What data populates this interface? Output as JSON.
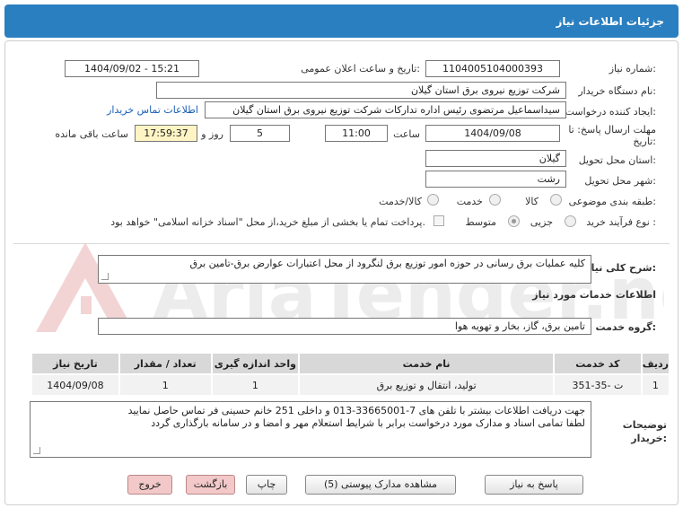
{
  "header": {
    "title": "جزئیات اطلاعات نیاز"
  },
  "fields": {
    "need_number_label": "شماره نیاز:",
    "need_number": "1104005104000393",
    "announce_label": "تاریخ و ساعت اعلان عمومی:",
    "announce_value": "1404/09/02 - 15:21",
    "buyer_org_label": "نام دستگاه خریدار:",
    "buyer_org": "شرکت توزیع نیروی برق استان گیلان",
    "creator_label": "ایجاد کننده درخواست:",
    "creator": "سیداسماعیل مرتضوی رئیس اداره تدارکات شرکت توزیع نیروی برق استان گیلان",
    "contact_link": "اطلاعات تماس خریدار",
    "deadline_label": "مهلت ارسال پاسخ: تا تاریخ:",
    "deadline_date": "1404/09/08",
    "time_label": "ساعت",
    "deadline_time": "11:00",
    "days_value": "5",
    "days_label": "روز و",
    "remaining_time": "17:59:37",
    "remaining_label": "ساعت باقی مانده",
    "province_label": "استان محل تحویل:",
    "province": "گیلان",
    "city_label": "شهر محل تحویل:",
    "city": "رشت",
    "category_label": "طبقه بندی موضوعی:",
    "category_options": [
      "کالا",
      "خدمت",
      "کالا/خدمت"
    ],
    "process_label": "نوع فرآیند خرید :",
    "process_options": [
      "جزیی",
      "متوسط"
    ],
    "payment_note": "پرداخت تمام یا بخشی از مبلغ خرید،از محل \"اسناد خزانه اسلامی\" خواهد بود."
  },
  "summary": {
    "label": "شرح کلی نیاز:",
    "text": "کلیه عملیات برق رسانی در حوزه امور توزیع برق لنگرود از محل اعتبارات عوارض برق-تامین برق"
  },
  "services_heading": "اطلاعات خدمات مورد نیاز",
  "service_group": {
    "label": "گروه خدمت:",
    "value": "تامین برق، گاز، بخار و تهویه هوا"
  },
  "table": {
    "headers": [
      "ردیف",
      "کد خدمت",
      "نام خدمت",
      "واحد اندازه گیری",
      "تعداد / مقدار",
      "تاریخ نیاز"
    ],
    "rows": [
      [
        "1",
        "ت -35-351",
        "تولید، انتقال و توزیع برق",
        "1",
        "1",
        "1404/09/08"
      ]
    ]
  },
  "buyer_notes": {
    "label": "توضیحات خریدار:",
    "line1": "جهت دریافت اطلاعات بیشتر با تلفن های 7-33665001-013 و داخلی 251 خانم حسینی فر تماس حاصل نمایید",
    "line2": "لطفا تمامی اسناد و مدارک مورد درخواست برابر با شرایط استعلام مهر و امضا و در سامانه بارگذاری گردد"
  },
  "buttons": {
    "reply": "پاسخ به نیاز",
    "docs": "مشاهده مدارک پیوستی (5)",
    "print": "چاپ",
    "back": "بازگشت",
    "exit": "خروج"
  },
  "watermark": "AriaTender.net",
  "colors": {
    "title_bar": "#2a7fc0",
    "remaining_bg": "#fff4c4",
    "link": "#1a5fb4",
    "pink_button": "#f2c8c8"
  }
}
